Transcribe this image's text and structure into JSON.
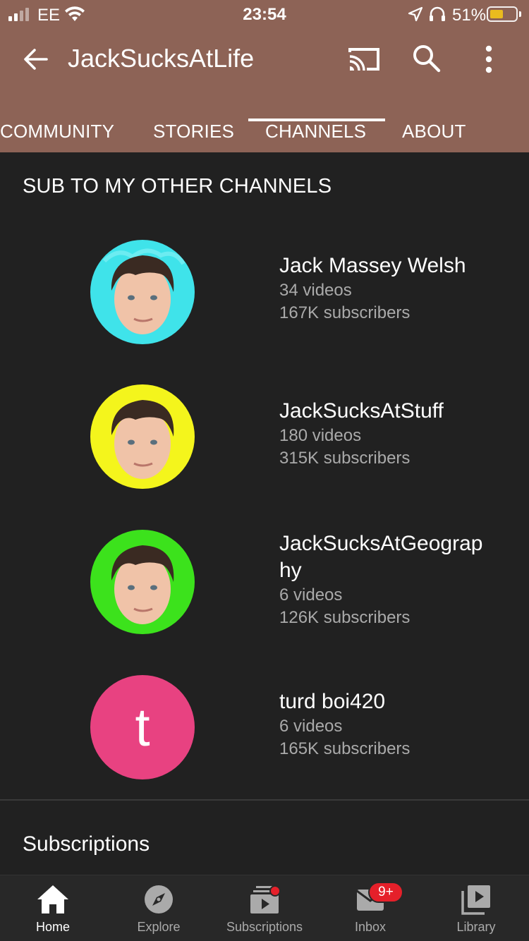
{
  "status_bar": {
    "carrier": "EE",
    "time": "23:54",
    "battery": "51%",
    "battery_level": 0.51,
    "icons": [
      "signal-icon",
      "wifi-icon",
      "location-arrow-icon",
      "headphones-icon",
      "battery-icon"
    ]
  },
  "app_bar": {
    "title": "JackSucksAtLife",
    "icons": [
      "back-arrow-icon",
      "cast-icon",
      "search-icon",
      "more-vert-icon"
    ]
  },
  "tabs": [
    {
      "label": "COMMUNITY",
      "active": false
    },
    {
      "label": "STORIES",
      "active": false
    },
    {
      "label": "CHANNELS",
      "active": true
    },
    {
      "label": "ABOUT",
      "active": false
    }
  ],
  "section": {
    "title": "SUB TO MY OTHER CHANNELS"
  },
  "channels": [
    {
      "name": "Jack Massey Welsh",
      "videos": "34 videos",
      "subscribers": "167K subscribers",
      "avatar_bg": "#3fe3ea"
    },
    {
      "name": "JackSucksAtStuff",
      "videos": "180 videos",
      "subscribers": "315K subscribers",
      "avatar_bg": "#f4f51c"
    },
    {
      "name": "JackSucksAtGeograp hy",
      "name_line1": "JackSucksAtGeograp",
      "name_line2": "hy",
      "videos": "6 videos",
      "subscribers": "126K subscribers",
      "avatar_bg": "#3ce21c"
    },
    {
      "name": "turd boi420",
      "videos": "6 videos",
      "subscribers": "165K subscribers",
      "avatar_letter": "t",
      "avatar_bg": "#e84281"
    }
  ],
  "subscriptions_heading": "Subscriptions",
  "bottom_nav": [
    {
      "label": "Home",
      "icon": "home-icon",
      "active": true
    },
    {
      "label": "Explore",
      "icon": "explore-icon",
      "active": false
    },
    {
      "label": "Subscriptions",
      "icon": "subscriptions-icon",
      "active": false
    },
    {
      "label": "Inbox",
      "icon": "inbox-icon",
      "active": false,
      "badge": "9+"
    },
    {
      "label": "Library",
      "icon": "library-icon",
      "active": false
    }
  ],
  "colors": {
    "header_bg": "#8d6356",
    "page_bg": "#212121",
    "nav_bg": "#282828",
    "badge": "#e5202a"
  }
}
